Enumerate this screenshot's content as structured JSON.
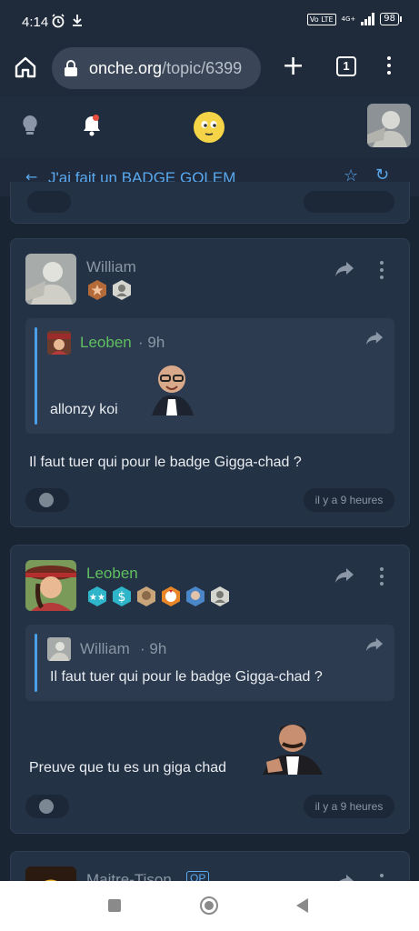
{
  "status_bar": {
    "time": "4:14",
    "volte": "Vo LTE",
    "network": "4G+",
    "battery": "98"
  },
  "browser": {
    "url_host": "onche.org",
    "url_path": "/topic/6399",
    "tab_count": "1"
  },
  "topic": {
    "title": "J'ai fait un BADGE GOLEM"
  },
  "posts": [
    {
      "author": "William",
      "author_color": "#8b97a6",
      "quote": {
        "author": "Leoben",
        "author_color": "#5fbf5f",
        "time": "9h",
        "text": "allonzy koi"
      },
      "message": "Il faut tuer qui pour le badge Gigga-chad ?",
      "timestamp": "il y a 9 heures"
    },
    {
      "author": "Leoben",
      "author_color": "#5fbf5f",
      "quote": {
        "author": "William",
        "author_color": "#8b97a6",
        "time": "9h",
        "text": "Il faut tuer qui pour le badge Gigga-chad ?"
      },
      "message": "Preuve que tu es un giga chad",
      "timestamp": "il y a 9 heures"
    },
    {
      "author": "Maitre-Tison",
      "author_color": "#8b97a6",
      "op_label": "OP"
    }
  ],
  "colors": {
    "accent": "#5aa9ef",
    "bg": "#1a2533",
    "card": "#243245"
  }
}
